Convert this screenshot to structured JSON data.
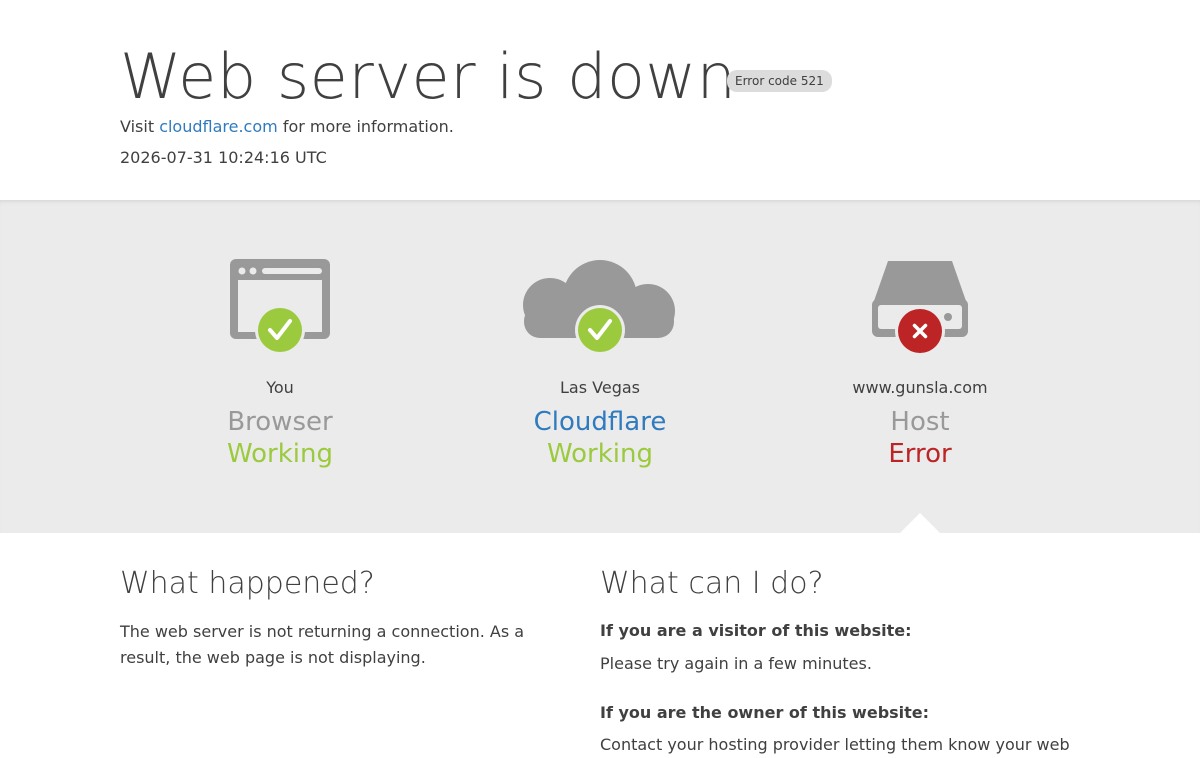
{
  "header": {
    "title": "Web server is down",
    "error_badge": "Error code 521",
    "visit_prefix": "Visit",
    "visit_link": "cloudflare.com",
    "visit_suffix": "for more information.",
    "timestamp": "2026-07-31 10:24:16 UTC"
  },
  "nodes": [
    {
      "location": "You",
      "name": "Browser",
      "state": "Working",
      "status": "ok",
      "icon": "browser-icon"
    },
    {
      "location": "Las Vegas",
      "name": "Cloudflare",
      "state": "Working",
      "status": "ok",
      "icon": "cloud-icon"
    },
    {
      "location": "www.gunsla.com",
      "name": "Host",
      "state": "Error",
      "status": "error",
      "icon": "server-icon"
    }
  ],
  "colors": {
    "working": "#9bca3e",
    "error": "#bd2426",
    "link": "#2f7bbf",
    "icon_gray": "#999999"
  },
  "what_happened": {
    "heading": "What happened?",
    "body": "The web server is not returning a connection. As a result, the web page is not displaying."
  },
  "what_can_i_do": {
    "heading": "What can I do?",
    "visitor_heading": "If you are a visitor of this website:",
    "visitor_body": "Please try again in a few minutes.",
    "owner_heading": "If you are the owner of this website:",
    "owner_body": "Contact your hosting provider letting them know your web"
  }
}
